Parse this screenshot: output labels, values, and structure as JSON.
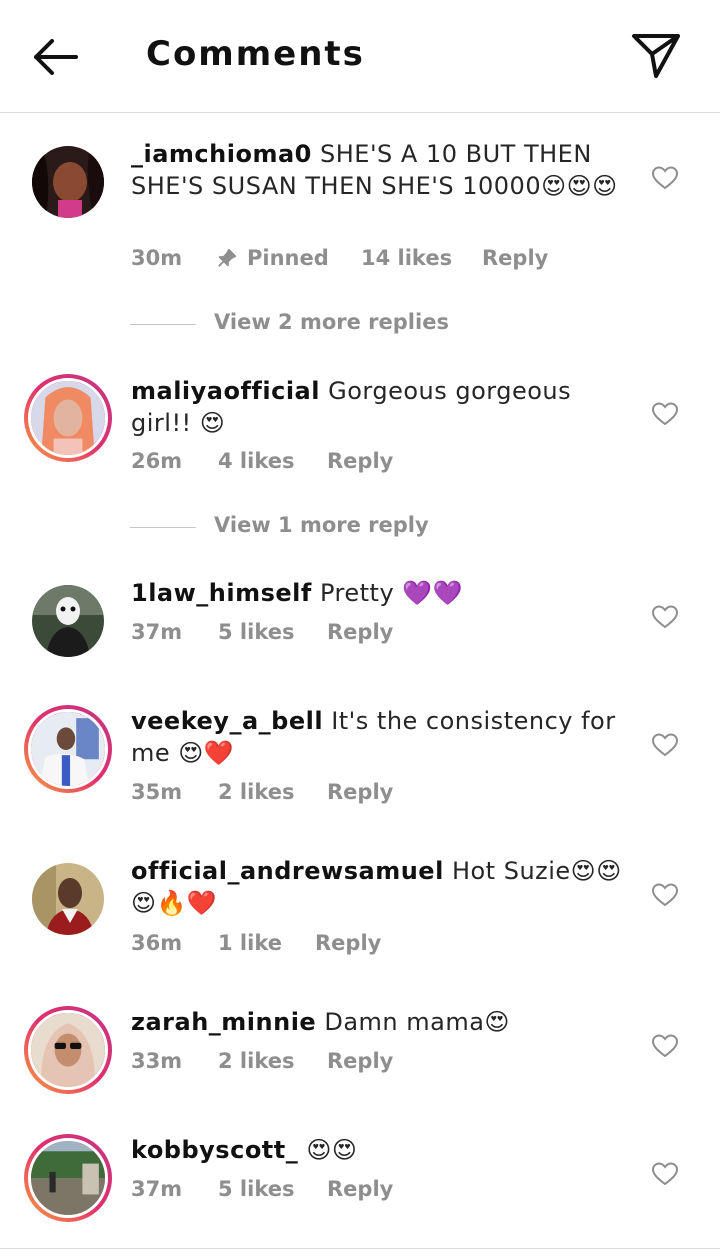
{
  "header": {
    "title": "Comments"
  },
  "comments": [
    {
      "username": "_iamchioma0",
      "text": "SHE'S A 10 BUT THEN SHE'S SUSAN THEN SHE'S 10000😍😍😍",
      "time": "30m",
      "pinned": "Pinned",
      "likes": "14 likes",
      "reply": "Reply"
    },
    {
      "username": "maliyaofficial",
      "text": "Gorgeous gorgeous girl!! 😍",
      "time": "26m",
      "likes": "4 likes",
      "reply": "Reply"
    },
    {
      "username": "1law_himself",
      "text": "Pretty 💜💜",
      "time": "37m",
      "likes": "5 likes",
      "reply": "Reply"
    },
    {
      "username": "veekey_a_bell",
      "text": "It's the consistency for me 😍❤️",
      "time": "35m",
      "likes": "2 likes",
      "reply": "Reply"
    },
    {
      "username": "official_andrewsamuel",
      "text": "Hot Suzie😍😍😍🔥❤️",
      "time": "36m",
      "likes": "1 like",
      "reply": "Reply"
    },
    {
      "username": "zarah_minnie",
      "text": "Damn mama😍",
      "time": "33m",
      "likes": "2 likes",
      "reply": "Reply"
    },
    {
      "username": "kobbyscott_",
      "text": "😍😍",
      "time": "37m",
      "likes": "5 likes",
      "reply": "Reply"
    }
  ],
  "view_more": [
    {
      "label": "View 2 more replies"
    },
    {
      "label": "View 1 more reply"
    }
  ],
  "icons": {
    "back": "arrow-left-icon",
    "send": "paper-plane-icon",
    "like": "heart-outline-icon",
    "pin": "pin-icon"
  },
  "colors": {
    "text": "#262626",
    "secondary": "#8e8e8e",
    "divider": "#dbdbdb",
    "story_ring_start": "#f9a03f",
    "story_ring_end": "#c13584"
  }
}
